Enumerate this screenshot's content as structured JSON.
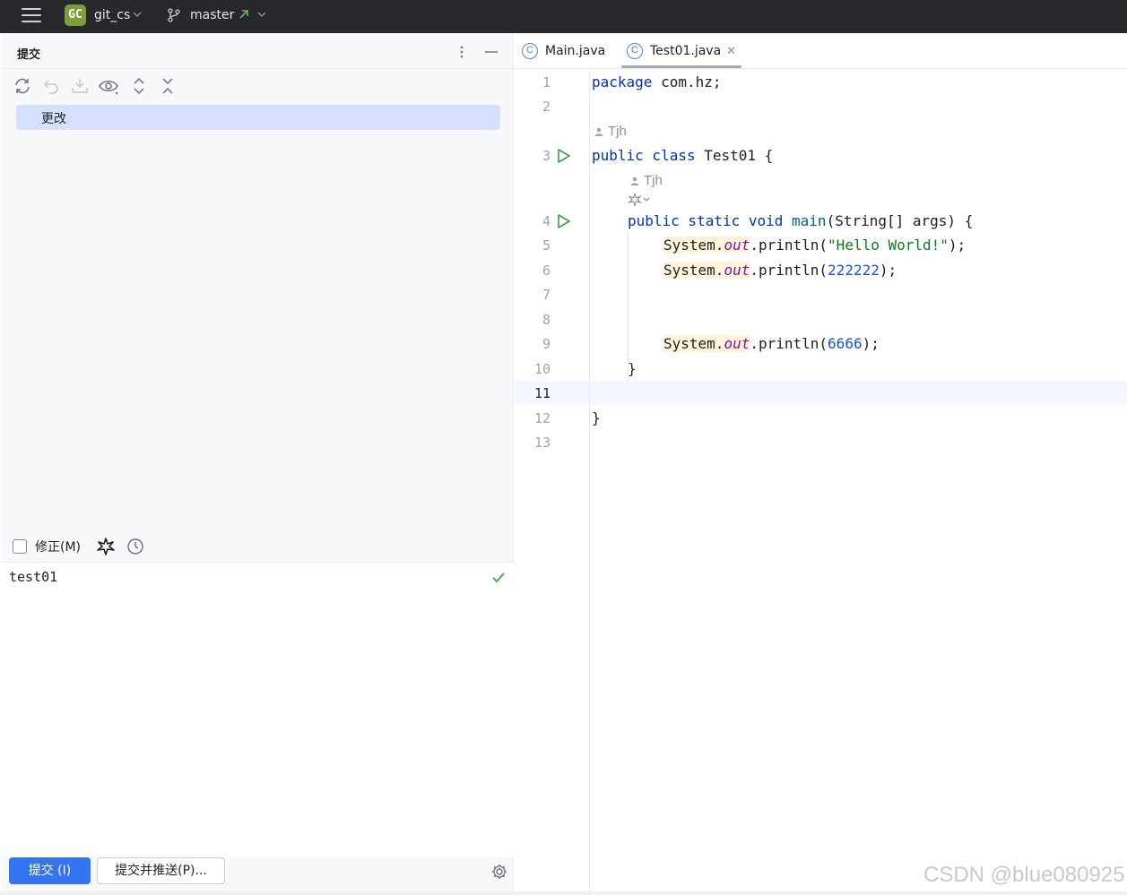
{
  "toolbar": {
    "project_badge": "GC",
    "project_name": "git_cs",
    "branch_name": "master"
  },
  "commit_panel": {
    "title": "提交",
    "changes_label": "更改",
    "amend_label": "修正(M)",
    "commit_message": "test01",
    "commit_button": "提交 (I)",
    "commit_push_button": "提交并推送(P)..."
  },
  "editor": {
    "tabs": [
      {
        "label": "Main.java",
        "icon": "class-icon",
        "active": false
      },
      {
        "label": "Test01.java",
        "icon": "class-icon",
        "active": true
      }
    ],
    "line_numbers": [
      "1",
      "2",
      "3",
      "4",
      "5",
      "6",
      "7",
      "8",
      "9",
      "10",
      "11",
      "12",
      "13"
    ],
    "current_line": "11",
    "author_hint": "Tjh",
    "code": {
      "l1_kw": "package",
      "l1_rest": " com.hz;",
      "l3_kw": "public class",
      "l3_rest": " Test01 {",
      "l4_kw": "public static void",
      "l4_fn": "main",
      "l4_rest": "(String[] args) {",
      "sys": "System.",
      "out": "out",
      "println": ".println(",
      "hello": "\"Hello World!\"",
      "num1": "222222",
      "num2": "6666",
      "close_paren": ");",
      "brace": "}"
    }
  },
  "watermark": "CSDN @blue080925"
}
